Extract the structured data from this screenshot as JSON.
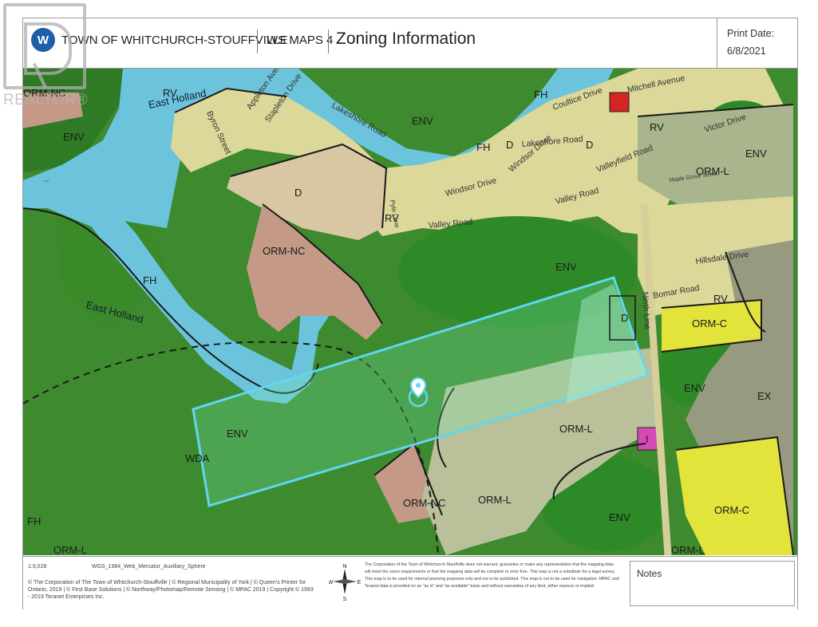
{
  "header": {
    "logo_glyph": "W",
    "org_name": "TOWN OF WHITCHURCH-STOUFFVILLE",
    "product_name": "WS MAPS 4",
    "title": "Zoning Information",
    "print_date_label": "Print Date:",
    "print_date": "6/8/2021"
  },
  "watermark": {
    "text": "REALTOR®"
  },
  "map": {
    "zones": {
      "env": [
        "ENV",
        "ENV",
        "ENV",
        "ENV",
        "ENV",
        "ENV",
        "ENV"
      ],
      "orm_nc": [
        "ORM-NC",
        "ORM-NC",
        "ORM-NC"
      ],
      "rv": [
        "RV",
        "RV",
        "RV",
        "RV"
      ],
      "fh": [
        "FH",
        "FH",
        "FH",
        "FH"
      ],
      "d": [
        "D",
        "D",
        "D",
        "D"
      ],
      "orm_l": [
        "ORM-L",
        "ORM-L",
        "ORM-L",
        "ORM-L",
        "ORM-L"
      ],
      "orm_c": [
        "ORM-C",
        "ORM-C"
      ],
      "ex": "EX",
      "i": "I",
      "wda": "WDA"
    },
    "streets": {
      "byron": "Byron Street",
      "appleton": "Appleton Avenue",
      "stapleton": "Stapleton Drive",
      "lakeshore1": "Lakeshore Road",
      "lakeshore2": "Lakeshore Road",
      "coultice": "Coultice Drive",
      "mitchell": "Mitchell Avenue",
      "victor": "Victor Drive",
      "windsor1": "Windsor Drive",
      "windsor2": "Windsor Drive",
      "valleyfield": "Valleyfield Road",
      "maple_grove": "Maple Grove Street",
      "valley1": "Valley Road",
      "valley2": "Valley Road",
      "pyle": "Pyle Lane",
      "hillsdale": "Hillsdale Drive",
      "bomar": "Bomar Road",
      "ninth": "Ninth Line"
    },
    "water": {
      "east_holland_top": "East Holland",
      "east_holland_mid": "East Holland"
    }
  },
  "footer": {
    "scale": "1:9,028",
    "projection": "WGS_1984_Web_Mercator_Auxiliary_Sphere",
    "copyright_1": "© The Corporation of The Town of Whitchurch-Stouffville | © Regional Municipality of York | © Queen's Printer for",
    "copyright_2": "Ontario, 2019 | © First Base Solutions | © Northway/Photomap/Remote Sensing | © MPAC 2019 | Copyright © 1993",
    "copyright_3": "- 2019 Teranet Enterprises Inc.",
    "disclaimer_1": "The Corporation of the Town of Whitchurch-Stouffville does not warrant, guarantee or make any representation that the mapping data",
    "disclaimer_2": "will meet the users requirements or that the mapping data will be complete or error free. This map is not a substitute for a legal survey.",
    "disclaimer_3": "This map is to be used for internal planning purposes only and not to be published. This map is not to be used for navigation. MPAC and",
    "disclaimer_4": "Teranet data is provided on an \"as is\" and \"as available\" basis and without warranties of any kind, either express or implied.",
    "compass": {
      "n": "N",
      "s": "S",
      "e": "E",
      "w": "W"
    },
    "notes_label": "Notes"
  },
  "colors": {
    "env": "#3e8a2e",
    "water": "#6cc4dc",
    "residential": "#dcd89a",
    "development": "#d8c7a2",
    "orm_nc": "#c49a86",
    "orm_l": "#b9c09a",
    "orm_c": "#e2e43c",
    "subject_outline": "#5fd7f2",
    "industrial": "#d64ab6",
    "marker": "#e03030"
  }
}
